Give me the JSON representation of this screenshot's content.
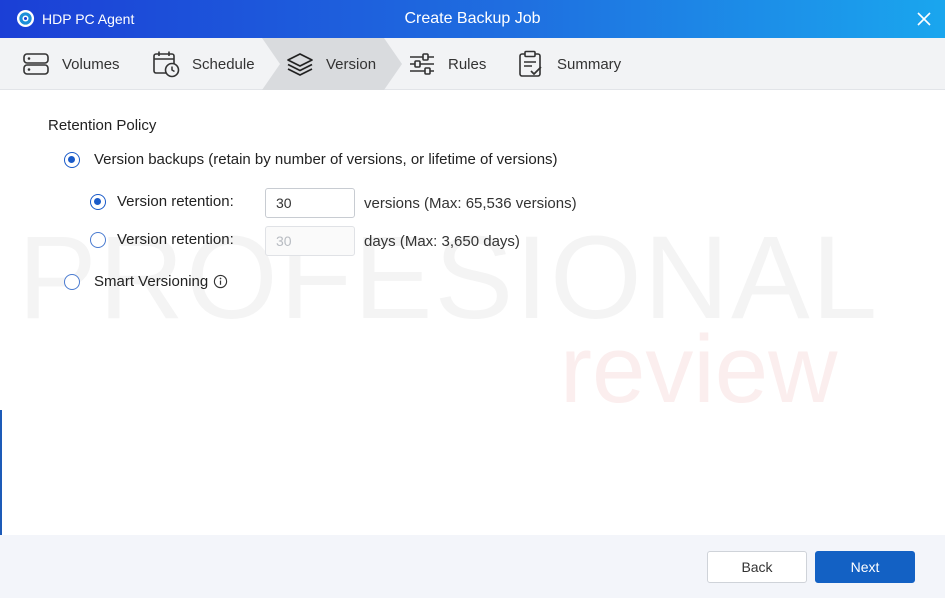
{
  "titlebar": {
    "app_name": "HDP PC Agent",
    "window_title": "Create Backup Job"
  },
  "steps": [
    {
      "label": "Volumes",
      "icon": "server-icon"
    },
    {
      "label": "Schedule",
      "icon": "calendar-clock-icon"
    },
    {
      "label": "Version",
      "icon": "layers-icon",
      "active": true
    },
    {
      "label": "Rules",
      "icon": "sliders-icon"
    },
    {
      "label": "Summary",
      "icon": "clipboard-check-icon"
    }
  ],
  "retention": {
    "title": "Retention Policy",
    "version_backups_label": "Version backups (retain by number of versions, or lifetime of versions)",
    "version_retention_label": "Version retention:",
    "versions_value": "30",
    "versions_unit": "versions (Max: 65,536 versions)",
    "days_value": "30",
    "days_unit": "days (Max: 3,650 days)",
    "smart_versioning_label": "Smart Versioning"
  },
  "watermark": {
    "line1": "PROFESIONAL",
    "line2": "review"
  },
  "footer": {
    "back_label": "Back",
    "next_label": "Next"
  },
  "colors": {
    "accent": "#1361c4",
    "titlebar_start": "#1b3fd6",
    "titlebar_end": "#1aa6ee"
  }
}
